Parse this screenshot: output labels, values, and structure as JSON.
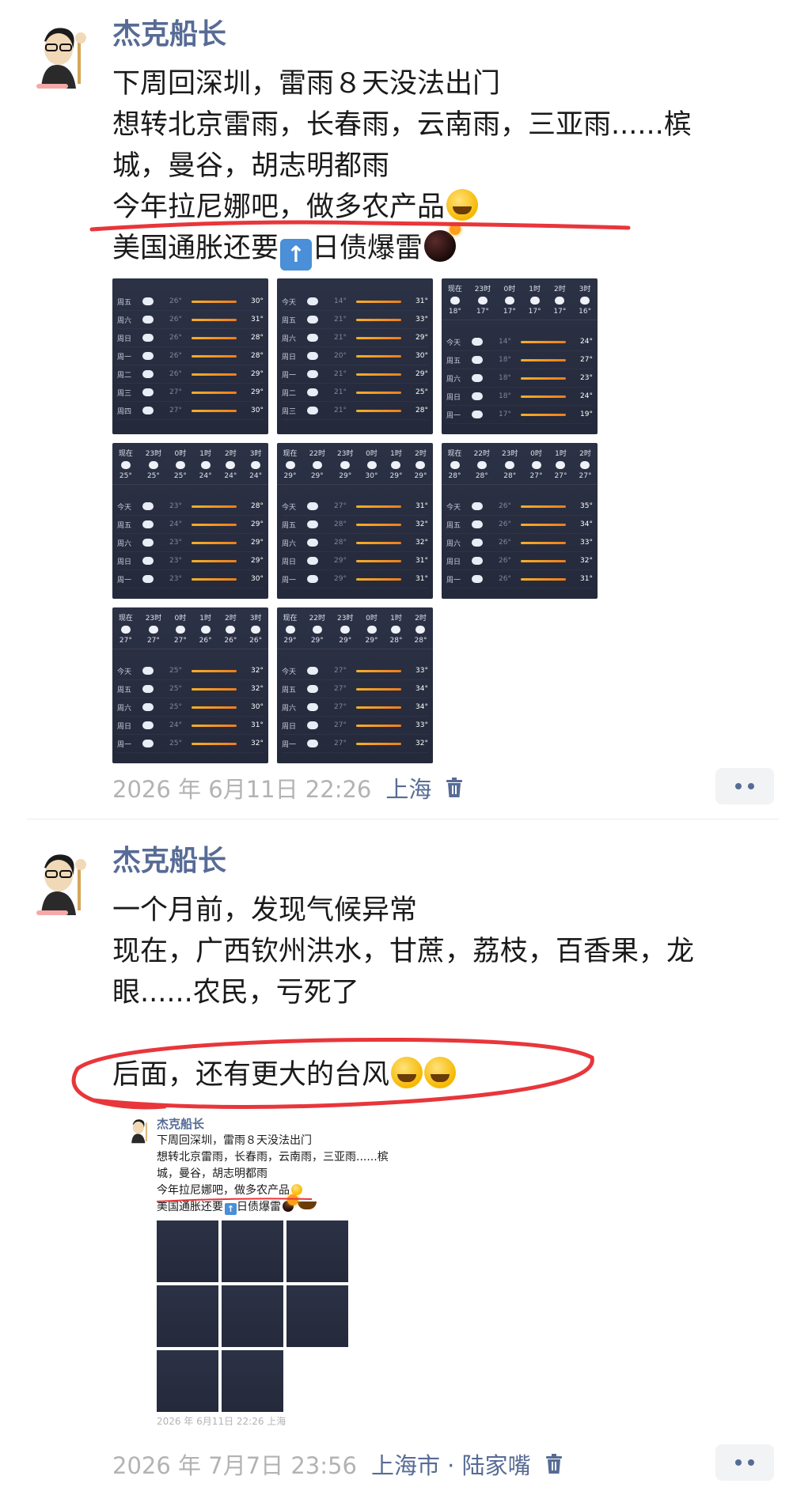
{
  "colors": {
    "name": "#576b95",
    "meta": "#b3b3b3",
    "highlight_red": "#e8363b",
    "card_bg": "#262c3d"
  },
  "post1": {
    "author": "杰克船长",
    "lines": [
      "下周回深圳，雷雨８天没法出门",
      "想转北京雷雨，长春雨，云南雨，三亚雨......槟",
      "城，曼谷，胡志明都雨",
      "今年拉尼娜吧，做多农产品",
      "美国通胀还要",
      "日债爆雷"
    ],
    "images": [
      {
        "type": "daily",
        "rows": [
          [
            "周五",
            "26°",
            "30°"
          ],
          [
            "周六",
            "26°",
            "31°"
          ],
          [
            "周日",
            "26°",
            "28°"
          ],
          [
            "周一",
            "26°",
            "28°"
          ],
          [
            "周二",
            "26°",
            "29°"
          ],
          [
            "周三",
            "27°",
            "29°"
          ],
          [
            "周四",
            "27°",
            "30°"
          ]
        ]
      },
      {
        "type": "daily",
        "rows": [
          [
            "今天",
            "14°",
            "31°"
          ],
          [
            "周五",
            "21°",
            "33°"
          ],
          [
            "周六",
            "21°",
            "29°"
          ],
          [
            "周日",
            "20°",
            "30°"
          ],
          [
            "周一",
            "21°",
            "29°"
          ],
          [
            "周二",
            "21°",
            "25°"
          ],
          [
            "周三",
            "21°",
            "28°"
          ]
        ]
      },
      {
        "type": "mixed",
        "hours": [
          [
            "现在",
            "18°"
          ],
          [
            "23时",
            "17°"
          ],
          [
            "0时",
            "17°"
          ],
          [
            "1时",
            "17°"
          ],
          [
            "2时",
            "17°"
          ],
          [
            "3时",
            "16°"
          ]
        ],
        "rows": [
          [
            "今天",
            "14°",
            "24°"
          ],
          [
            "周五",
            "18°",
            "27°"
          ],
          [
            "周六",
            "18°",
            "23°"
          ],
          [
            "周日",
            "18°",
            "24°"
          ],
          [
            "周一",
            "17°",
            "19°"
          ]
        ]
      },
      {
        "type": "mixed",
        "hours": [
          [
            "现在",
            "25°"
          ],
          [
            "23时",
            "25°"
          ],
          [
            "0时",
            "25°"
          ],
          [
            "1时",
            "24°"
          ],
          [
            "2时",
            "24°"
          ],
          [
            "3时",
            "24°"
          ]
        ],
        "rows": [
          [
            "今天",
            "23°",
            "28°"
          ],
          [
            "周五",
            "24°",
            "29°"
          ],
          [
            "周六",
            "23°",
            "29°"
          ],
          [
            "周日",
            "23°",
            "29°"
          ],
          [
            "周一",
            "23°",
            "30°"
          ]
        ]
      },
      {
        "type": "mixed",
        "hours": [
          [
            "现在",
            "29°"
          ],
          [
            "22时",
            "29°"
          ],
          [
            "23时",
            "29°"
          ],
          [
            "0时",
            "30°"
          ],
          [
            "1时",
            "29°"
          ],
          [
            "2时",
            "29°"
          ]
        ],
        "rows": [
          [
            "今天",
            "27°",
            "31°"
          ],
          [
            "周五",
            "28°",
            "32°"
          ],
          [
            "周六",
            "28°",
            "32°"
          ],
          [
            "周日",
            "29°",
            "31°"
          ],
          [
            "周一",
            "29°",
            "31°"
          ]
        ]
      },
      {
        "type": "mixed",
        "hours": [
          [
            "现在",
            "28°"
          ],
          [
            "22时",
            "28°"
          ],
          [
            "23时",
            "28°"
          ],
          [
            "0时",
            "27°"
          ],
          [
            "1时",
            "27°"
          ],
          [
            "2时",
            "27°"
          ]
        ],
        "rows": [
          [
            "今天",
            "26°",
            "35°"
          ],
          [
            "周五",
            "26°",
            "34°"
          ],
          [
            "周六",
            "26°",
            "33°"
          ],
          [
            "周日",
            "26°",
            "32°"
          ],
          [
            "周一",
            "26°",
            "31°"
          ]
        ]
      },
      {
        "type": "mixed",
        "hours": [
          [
            "现在",
            "27°"
          ],
          [
            "23时",
            "27°"
          ],
          [
            "0时",
            "27°"
          ],
          [
            "1时",
            "26°"
          ],
          [
            "2时",
            "26°"
          ],
          [
            "3时",
            "26°"
          ]
        ],
        "rows": [
          [
            "今天",
            "25°",
            "32°"
          ],
          [
            "周五",
            "25°",
            "32°"
          ],
          [
            "周六",
            "25°",
            "30°"
          ],
          [
            "周日",
            "24°",
            "31°"
          ],
          [
            "周一",
            "25°",
            "32°"
          ]
        ]
      },
      {
        "type": "mixed",
        "hours": [
          [
            "现在",
            "29°"
          ],
          [
            "22时",
            "29°"
          ],
          [
            "23时",
            "29°"
          ],
          [
            "0时",
            "29°"
          ],
          [
            "1时",
            "28°"
          ],
          [
            "2时",
            "28°"
          ]
        ],
        "rows": [
          [
            "今天",
            "27°",
            "33°"
          ],
          [
            "周五",
            "27°",
            "34°"
          ],
          [
            "周六",
            "27°",
            "34°"
          ],
          [
            "周日",
            "27°",
            "33°"
          ],
          [
            "周一",
            "27°",
            "32°"
          ]
        ]
      }
    ],
    "date": "2026 年 6月11日 22:26",
    "location": "上海"
  },
  "post2": {
    "author": "杰克船长",
    "lines": [
      "一个月前，发现气候异常",
      "现在，广西钦州洪水，甘蔗，荔枝，百香果，龙",
      "眼......农民，亏死了",
      "后面，还有更大的台风"
    ],
    "date": "2026 年 7月7日 23:56",
    "location": "上海市 · 陆家嘴",
    "nested": {
      "author": "杰克船长",
      "lines": [
        "下周回深圳，雷雨８天没法出门",
        "想转北京雷雨，长春雨，云南雨，三亚雨......槟",
        "城，曼谷，胡志明都雨",
        "今年拉尼娜吧，做多农产品",
        "美国通胀还要",
        "日债爆雷"
      ],
      "meta": "2026 年 6月11日 22:26  上海"
    }
  }
}
